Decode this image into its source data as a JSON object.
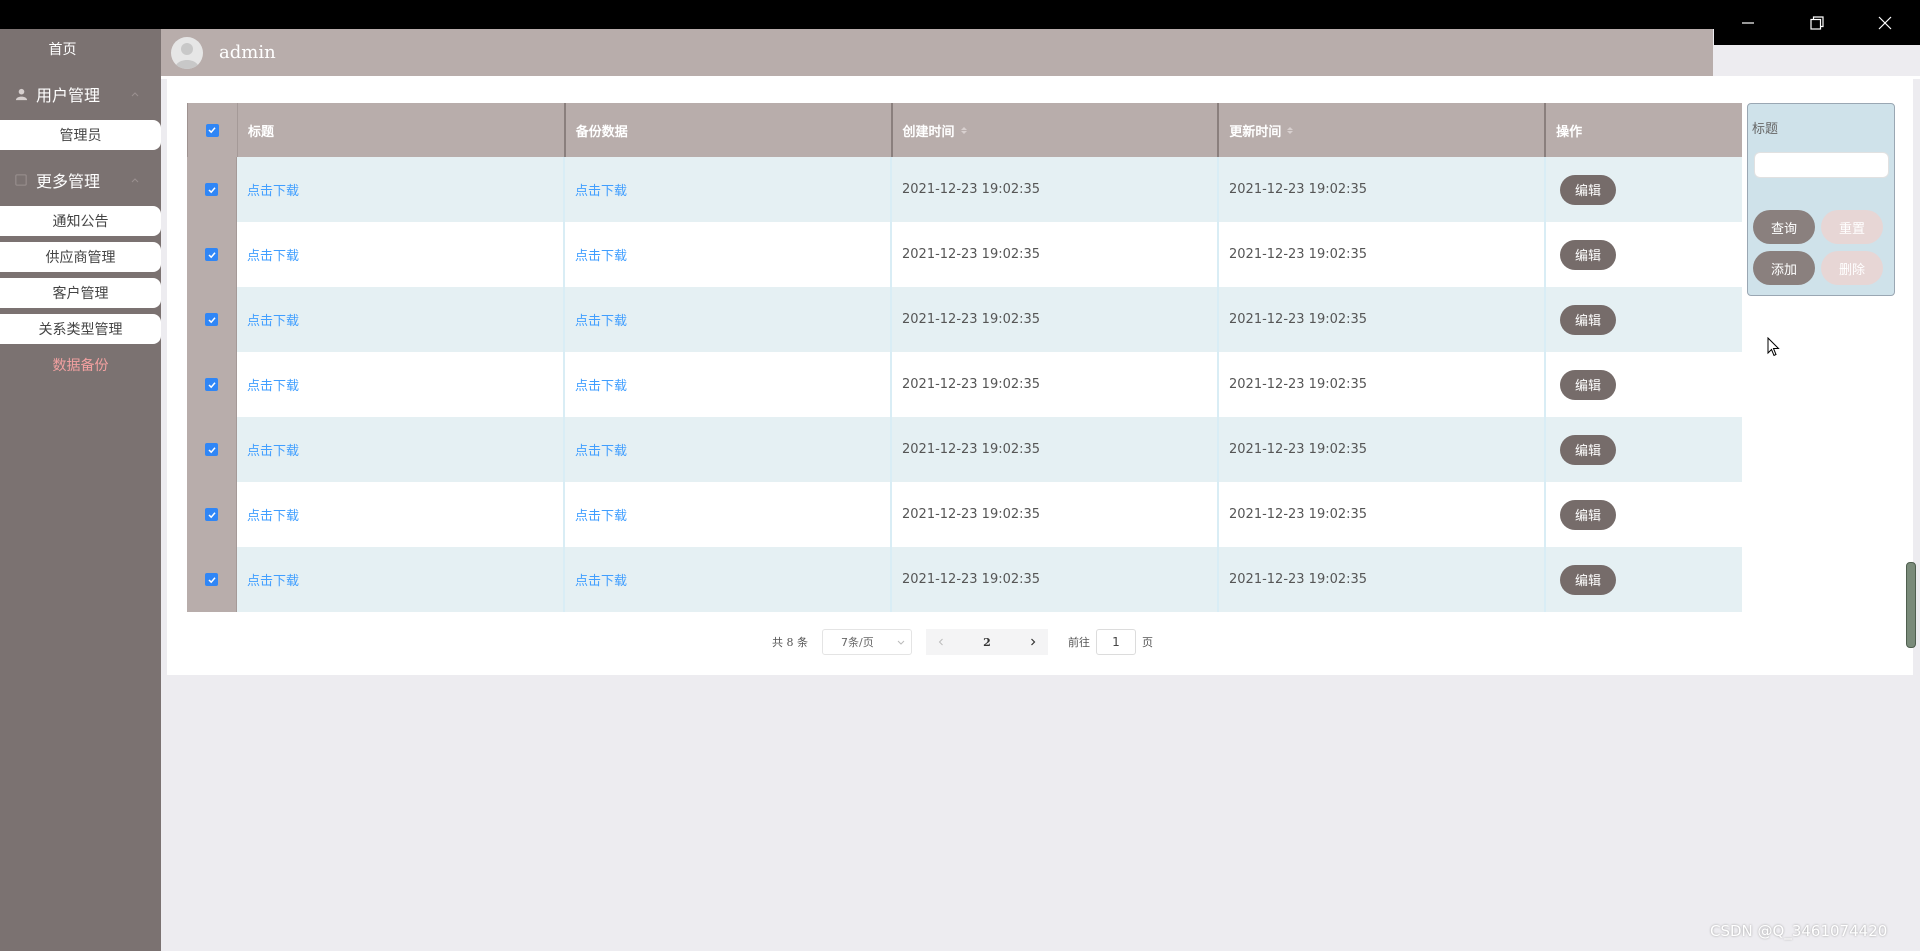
{
  "window": {
    "minimize_icon": "minimize-icon",
    "restore_icon": "restore-icon",
    "close_icon": "close-icon"
  },
  "sidebar": {
    "home": "首页",
    "groups": [
      {
        "label": "用户管理",
        "items": [
          "管理员"
        ]
      },
      {
        "label": "更多管理",
        "items": [
          "通知公告",
          "供应商管理",
          "客户管理",
          "关系类型管理"
        ]
      }
    ],
    "active_item": "数据备份"
  },
  "header": {
    "username": "admin"
  },
  "table": {
    "columns": [
      "标题",
      "备份数据",
      "创建时间",
      "更新时间",
      "操作"
    ],
    "rows": [
      {
        "title": "点击下载",
        "backup": "点击下载",
        "created": "2021-12-23 19:02:35",
        "updated": "2021-12-23 19:02:35",
        "action": "编辑"
      },
      {
        "title": "点击下载",
        "backup": "点击下载",
        "created": "2021-12-23 19:02:35",
        "updated": "2021-12-23 19:02:35",
        "action": "编辑"
      },
      {
        "title": "点击下载",
        "backup": "点击下载",
        "created": "2021-12-23 19:02:35",
        "updated": "2021-12-23 19:02:35",
        "action": "编辑"
      },
      {
        "title": "点击下载",
        "backup": "点击下载",
        "created": "2021-12-23 19:02:35",
        "updated": "2021-12-23 19:02:35",
        "action": "编辑"
      },
      {
        "title": "点击下载",
        "backup": "点击下载",
        "created": "2021-12-23 19:02:35",
        "updated": "2021-12-23 19:02:35",
        "action": "编辑"
      },
      {
        "title": "点击下载",
        "backup": "点击下载",
        "created": "2021-12-23 19:02:35",
        "updated": "2021-12-23 19:02:35",
        "action": "编辑"
      },
      {
        "title": "点击下载",
        "backup": "点击下载",
        "created": "2021-12-23 19:02:35",
        "updated": "2021-12-23 19:02:35",
        "action": "编辑"
      }
    ]
  },
  "search": {
    "label": "标题",
    "query": "查询",
    "reset": "重置",
    "add": "添加",
    "delete": "删除"
  },
  "pagination": {
    "total": "共 8 条",
    "page_size": "7条/页",
    "current_page": "2",
    "goto_label": "前往",
    "goto_value": "1",
    "page_unit": "页"
  },
  "watermark": "CSDN @Q_3461074420",
  "colors": {
    "sidebar": "#7b7271",
    "header": "#b8adab",
    "link": "#409eff",
    "row_stripe": "#e5f0f3",
    "edit_button": "#766c6a"
  }
}
